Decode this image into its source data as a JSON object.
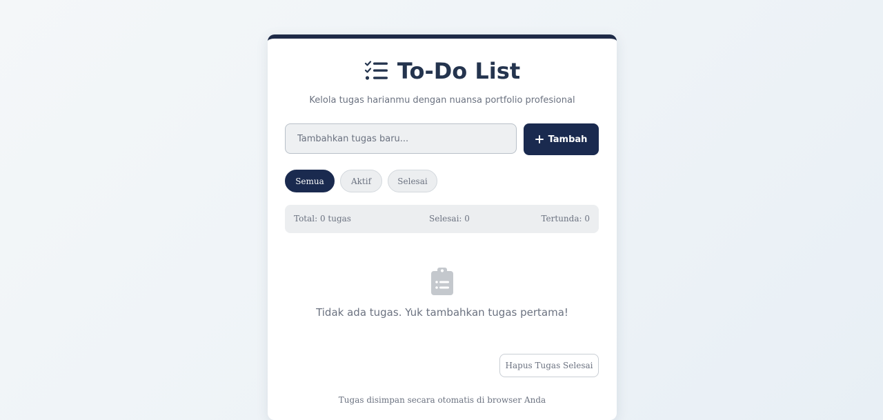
{
  "header": {
    "title": "To-Do List",
    "icon": "list-check-icon",
    "subtitle": "Kelola tugas harianmu dengan nuansa portfolio profesional"
  },
  "add_task": {
    "placeholder": "Tambahkan tugas baru...",
    "value": "",
    "button_label": "Tambah",
    "button_icon": "plus-icon"
  },
  "filters": {
    "selected": "Semua",
    "items": [
      {
        "label": "Semua",
        "active": true
      },
      {
        "label": "Aktif",
        "active": false
      },
      {
        "label": "Selesai",
        "active": false
      }
    ]
  },
  "stats": {
    "total": "Total: 0 tugas",
    "done": "Selesai: 0",
    "pending": "Tertunda: 0"
  },
  "empty_state": {
    "icon": "clipboard-list-icon",
    "message": "Tidak ada tugas. Yuk tambahkan tugas pertama!"
  },
  "actions": {
    "clear_done_label": "Hapus Tugas Selesai"
  },
  "footer": {
    "note": "Tugas disimpan secara otomatis di browser Anda"
  },
  "colors": {
    "accent": "#1a2a4f",
    "title": "#24344e",
    "muted_text": "#6b7280",
    "chip_bg": "#eceef0"
  }
}
